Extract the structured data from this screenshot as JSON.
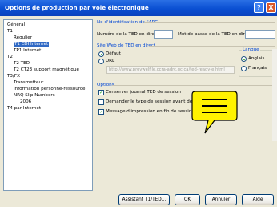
{
  "window": {
    "title": "Options de production par voie électronique"
  },
  "titlebar_buttons": {
    "help": "?",
    "close": "X"
  },
  "tree": [
    {
      "label": "Général"
    },
    {
      "label": "T1"
    },
    {
      "label": "Régulier"
    },
    {
      "label": "T1 EDI Internet",
      "selected": true
    },
    {
      "label": "TP1 Internet"
    },
    {
      "label": "T2"
    },
    {
      "label": "T2 TED"
    },
    {
      "label": "T2 CT23 support magnétique"
    },
    {
      "label": "T3/FX"
    },
    {
      "label": "Transmetteur"
    },
    {
      "label": "Information personne-ressource"
    },
    {
      "label": "NRQ Slip Numbers"
    },
    {
      "label": "2006"
    },
    {
      "label": "T4 par Internet"
    }
  ],
  "ident": {
    "group_title": "No d'identification de l'ARC",
    "ted_number_label": "Numéro de la TED en direct",
    "ted_number_value": "",
    "password_label": "Mot de passe de la TED en direct",
    "password_value": ""
  },
  "website": {
    "group_title": "Site Web de TED en direct",
    "default_label": "Défaut",
    "default_selected": true,
    "url_label": "URL",
    "url_selected": false,
    "url_value": "http://www.provwelfile.ccra-adrc.gc.ca/ted-ready-e.html"
  },
  "language": {
    "group_title": "Langue",
    "english_label": "Anglais",
    "english_selected": true,
    "french_label": "Français",
    "french_selected": false
  },
  "options": {
    "group_title": "Options",
    "items": [
      {
        "label": "Conserver journal TED de session",
        "checked": true
      },
      {
        "label": "Demander le type de session avant de s...",
        "checked": false
      },
      {
        "label": "Message d'impression en fin de session",
        "checked": true
      }
    ]
  },
  "buttons": {
    "assistant": "Assistant T1/TED...",
    "ok": "OK",
    "cancel": "Annuler",
    "help": "Aide"
  },
  "colors": {
    "accent": "#0a4fd2",
    "callout_fill": "#fff200",
    "selection": "#316ac5"
  }
}
